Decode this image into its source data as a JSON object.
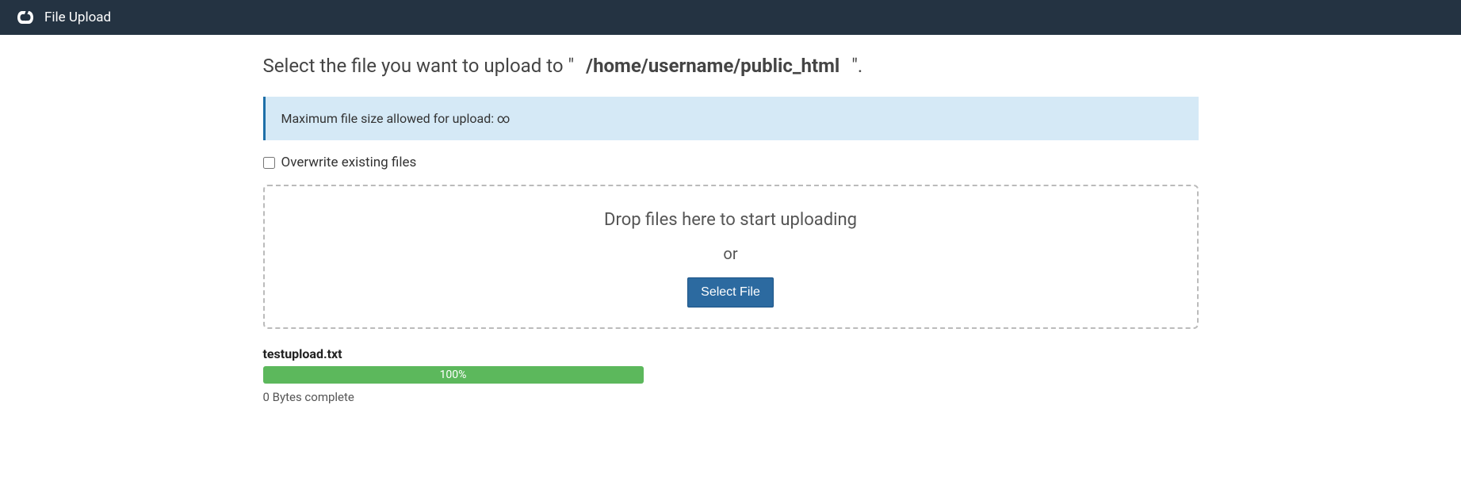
{
  "header": {
    "title": "File Upload"
  },
  "main": {
    "heading_prefix": "Select the file you want to upload to \"",
    "upload_path": "/home/username/public_html",
    "heading_suffix": "\".",
    "info_message": "Maximum file size allowed for upload: ∞",
    "overwrite_label": "Overwrite existing files",
    "dropzone": {
      "drop_text": "Drop files here to start uploading",
      "or_text": "or",
      "select_button": "Select File"
    },
    "upload_item": {
      "filename": "testupload.txt",
      "progress_percent": "100%",
      "complete_text": "0 Bytes complete"
    }
  }
}
